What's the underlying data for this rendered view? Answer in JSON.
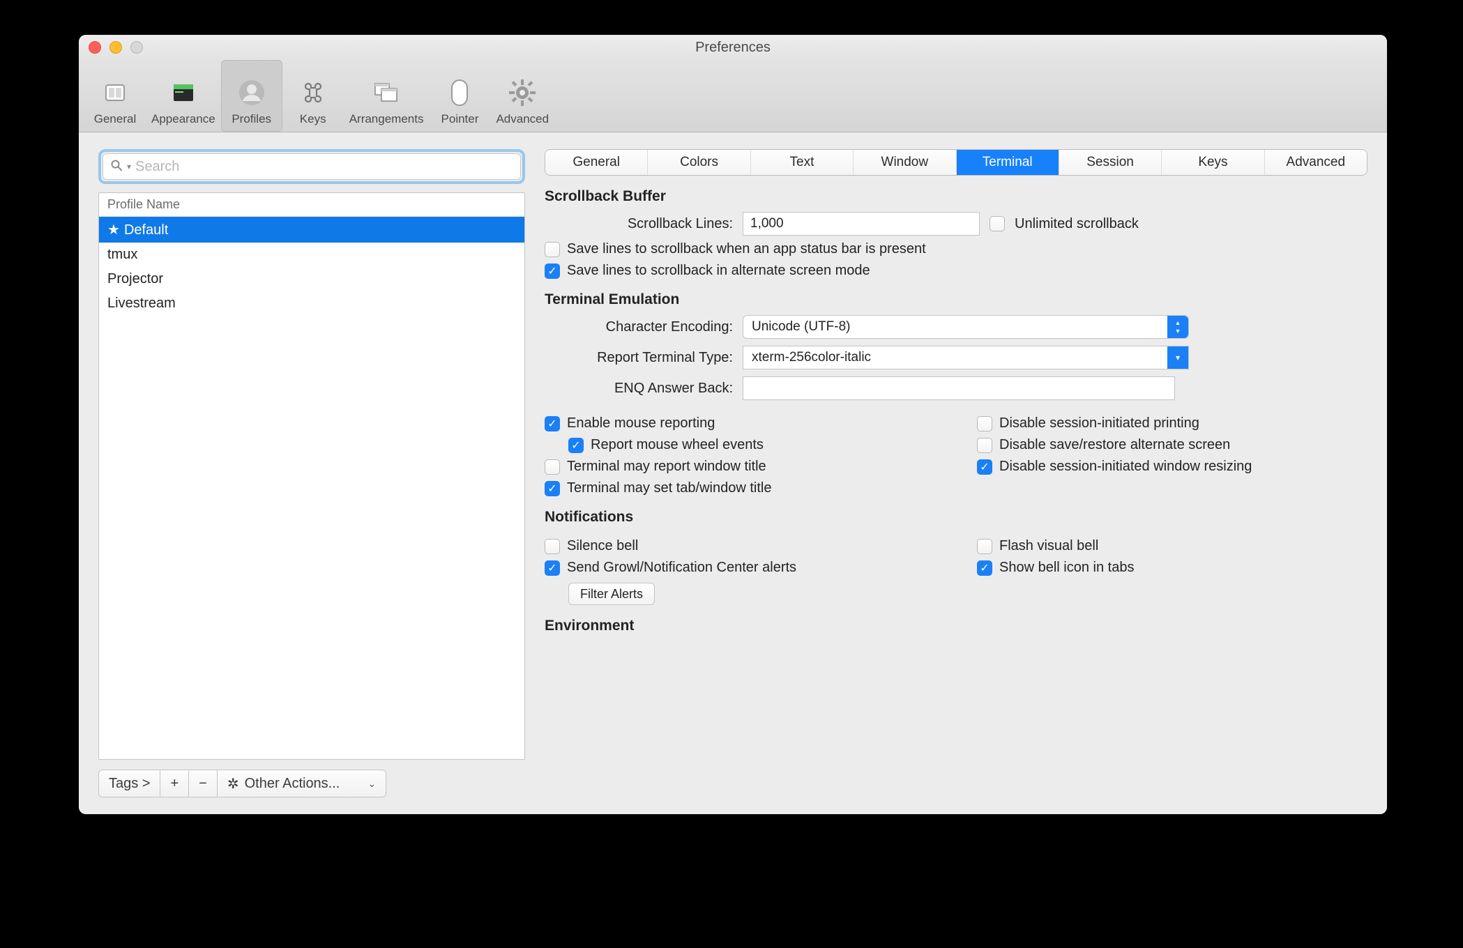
{
  "window": {
    "title": "Preferences"
  },
  "toolbar": {
    "items": [
      {
        "label": "General"
      },
      {
        "label": "Appearance"
      },
      {
        "label": "Profiles"
      },
      {
        "label": "Keys"
      },
      {
        "label": "Arrangements"
      },
      {
        "label": "Pointer"
      },
      {
        "label": "Advanced"
      }
    ],
    "active_index": 2
  },
  "sidebar": {
    "search_placeholder": "Search",
    "header": "Profile Name",
    "profiles": [
      {
        "label": "Default",
        "starred": true,
        "selected": true
      },
      {
        "label": "tmux",
        "starred": false,
        "selected": false
      },
      {
        "label": "Projector",
        "starred": false,
        "selected": false
      },
      {
        "label": "Livestream",
        "starred": false,
        "selected": false
      }
    ],
    "footer": {
      "tags_label": "Tags >",
      "add_label": "+",
      "remove_label": "−",
      "other_actions_label": "Other Actions..."
    }
  },
  "tabs": {
    "items": [
      "General",
      "Colors",
      "Text",
      "Window",
      "Terminal",
      "Session",
      "Keys",
      "Advanced"
    ],
    "active_index": 4
  },
  "sections": {
    "scrollback": {
      "title": "Scrollback Buffer",
      "lines_label": "Scrollback Lines:",
      "lines_value": "1,000",
      "unlimited_label": "Unlimited scrollback",
      "unlimited_checked": false,
      "save_statusbar_label": "Save lines to scrollback when an app status bar is present",
      "save_statusbar_checked": false,
      "save_alt_label": "Save lines to scrollback in alternate screen mode",
      "save_alt_checked": true
    },
    "emulation": {
      "title": "Terminal Emulation",
      "encoding_label": "Character Encoding:",
      "encoding_value": "Unicode (UTF-8)",
      "report_type_label": "Report Terminal Type:",
      "report_type_value": "xterm-256color-italic",
      "enq_label": "ENQ Answer Back:",
      "enq_value": "",
      "left": [
        {
          "label": "Enable mouse reporting",
          "checked": true
        },
        {
          "label": "Report mouse wheel events",
          "checked": true,
          "indent": true
        },
        {
          "label": "Terminal may report window title",
          "checked": false
        },
        {
          "label": "Terminal may set tab/window title",
          "checked": true
        }
      ],
      "right": [
        {
          "label": "Disable session-initiated printing",
          "checked": false
        },
        {
          "label": "Disable save/restore alternate screen",
          "checked": false
        },
        {
          "label": "Disable session-initiated window resizing",
          "checked": true
        }
      ]
    },
    "notifications": {
      "title": "Notifications",
      "left": [
        {
          "label": "Silence bell",
          "checked": false
        },
        {
          "label": "Send Growl/Notification Center alerts",
          "checked": true
        }
      ],
      "right": [
        {
          "label": "Flash visual bell",
          "checked": false
        },
        {
          "label": "Show bell icon in tabs",
          "checked": true
        }
      ],
      "filter_button": "Filter Alerts"
    },
    "environment": {
      "title": "Environment"
    }
  }
}
